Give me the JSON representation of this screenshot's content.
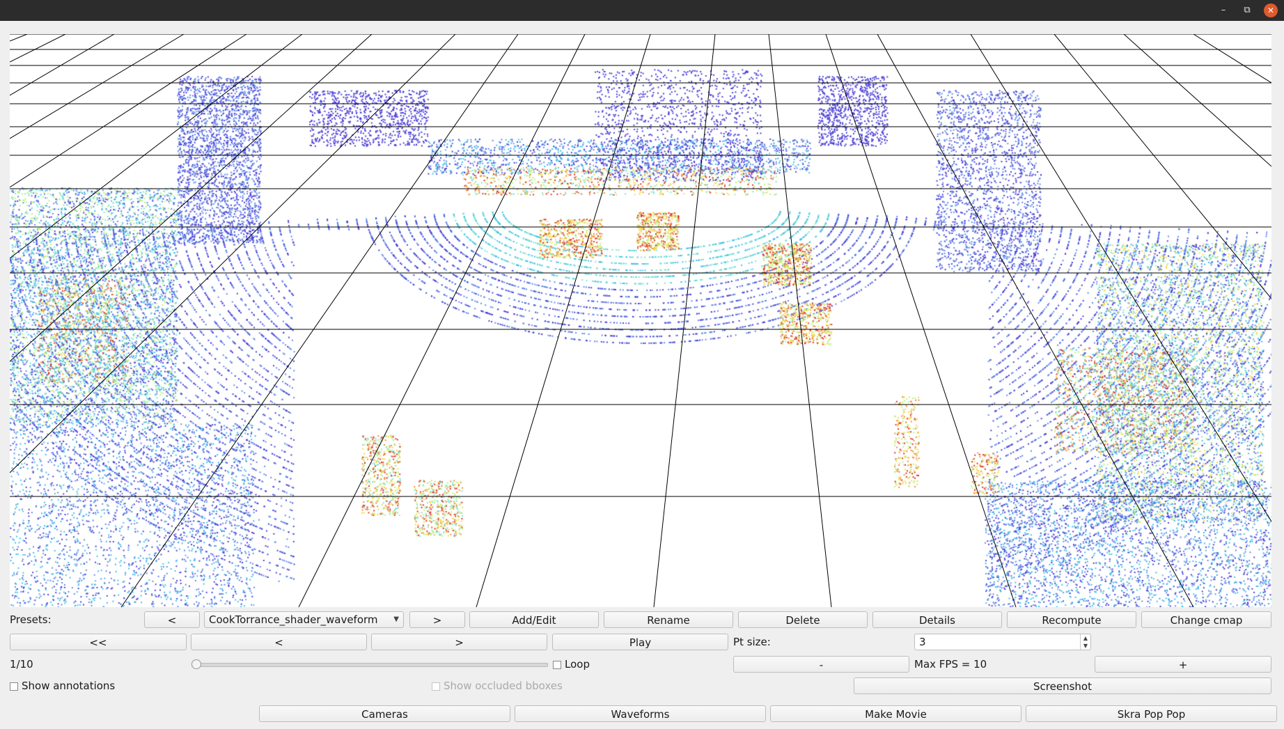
{
  "window": {
    "minimize_glyph": "–",
    "restore_glyph": "⧉",
    "close_glyph": "✕"
  },
  "theme": {
    "viewport_bg": "#ffffff",
    "grid_color": "#000000",
    "colormap": [
      "#4a3fd6",
      "#5f8ae8",
      "#3fc0e8",
      "#7be3d2",
      "#b9ef7a",
      "#f0d94a",
      "#f08a3a",
      "#d8322a"
    ]
  },
  "presets": {
    "label": "Presets:",
    "prev_label": "<",
    "selected": "CookTorrance_shader_waveform",
    "next_label": ">",
    "add_edit_label": "Add/Edit",
    "rename_label": "Rename",
    "delete_label": "Delete",
    "details_label": "Details",
    "recompute_label": "Recompute",
    "change_cmap_label": "Change cmap"
  },
  "playback": {
    "first_label": "<<",
    "prev_label": "<",
    "next_label": ">",
    "play_label": "Play",
    "frame_text": "1/10",
    "slider_fraction": 0.0,
    "loop_label": "Loop",
    "loop_checked": false
  },
  "point_size": {
    "label": "Pt size:",
    "value": "3",
    "up_glyph": "▲",
    "down_glyph": "▼"
  },
  "fps": {
    "minus_label": "-",
    "text": "Max FPS = 10",
    "plus_label": "+"
  },
  "annotations": {
    "show_annotations_label": "Show annotations",
    "show_annotations_checked": false,
    "show_occluded_label": "Show occluded bboxes",
    "show_occluded_checked": false,
    "show_occluded_enabled": false
  },
  "screenshot_label": "Screenshot",
  "bottom": {
    "cameras_label": "Cameras",
    "waveforms_label": "Waveforms",
    "make_movie_label": "Make Movie",
    "skra_label": "Skra Pop Pop"
  }
}
